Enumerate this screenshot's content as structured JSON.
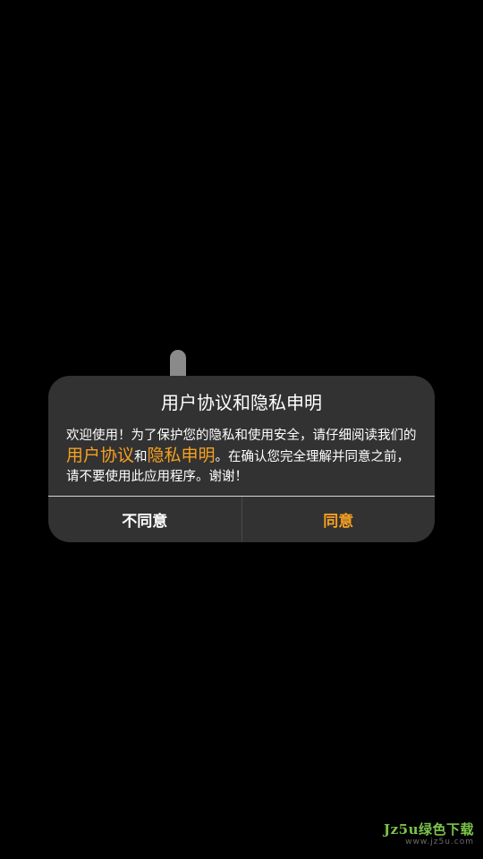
{
  "dialog": {
    "title": "用户协议和隐私申明",
    "body_prefix": "欢迎使用！为了保护您的隐私和使用安全，请仔细阅读我们的",
    "user_agreement_link": "用户协议",
    "body_and": "和",
    "privacy_link": "隐私申明",
    "body_suffix": "。在确认您完全理解并同意之前，请不要使用此应用程序。谢谢！",
    "disagree_label": "不同意",
    "agree_label": "同意"
  },
  "watermark": {
    "text": "Jz5u绿色下载",
    "url": "www.jz5u.com"
  },
  "colors": {
    "background": "#000000",
    "dialog": "#323232",
    "accent": "#f6a020"
  }
}
